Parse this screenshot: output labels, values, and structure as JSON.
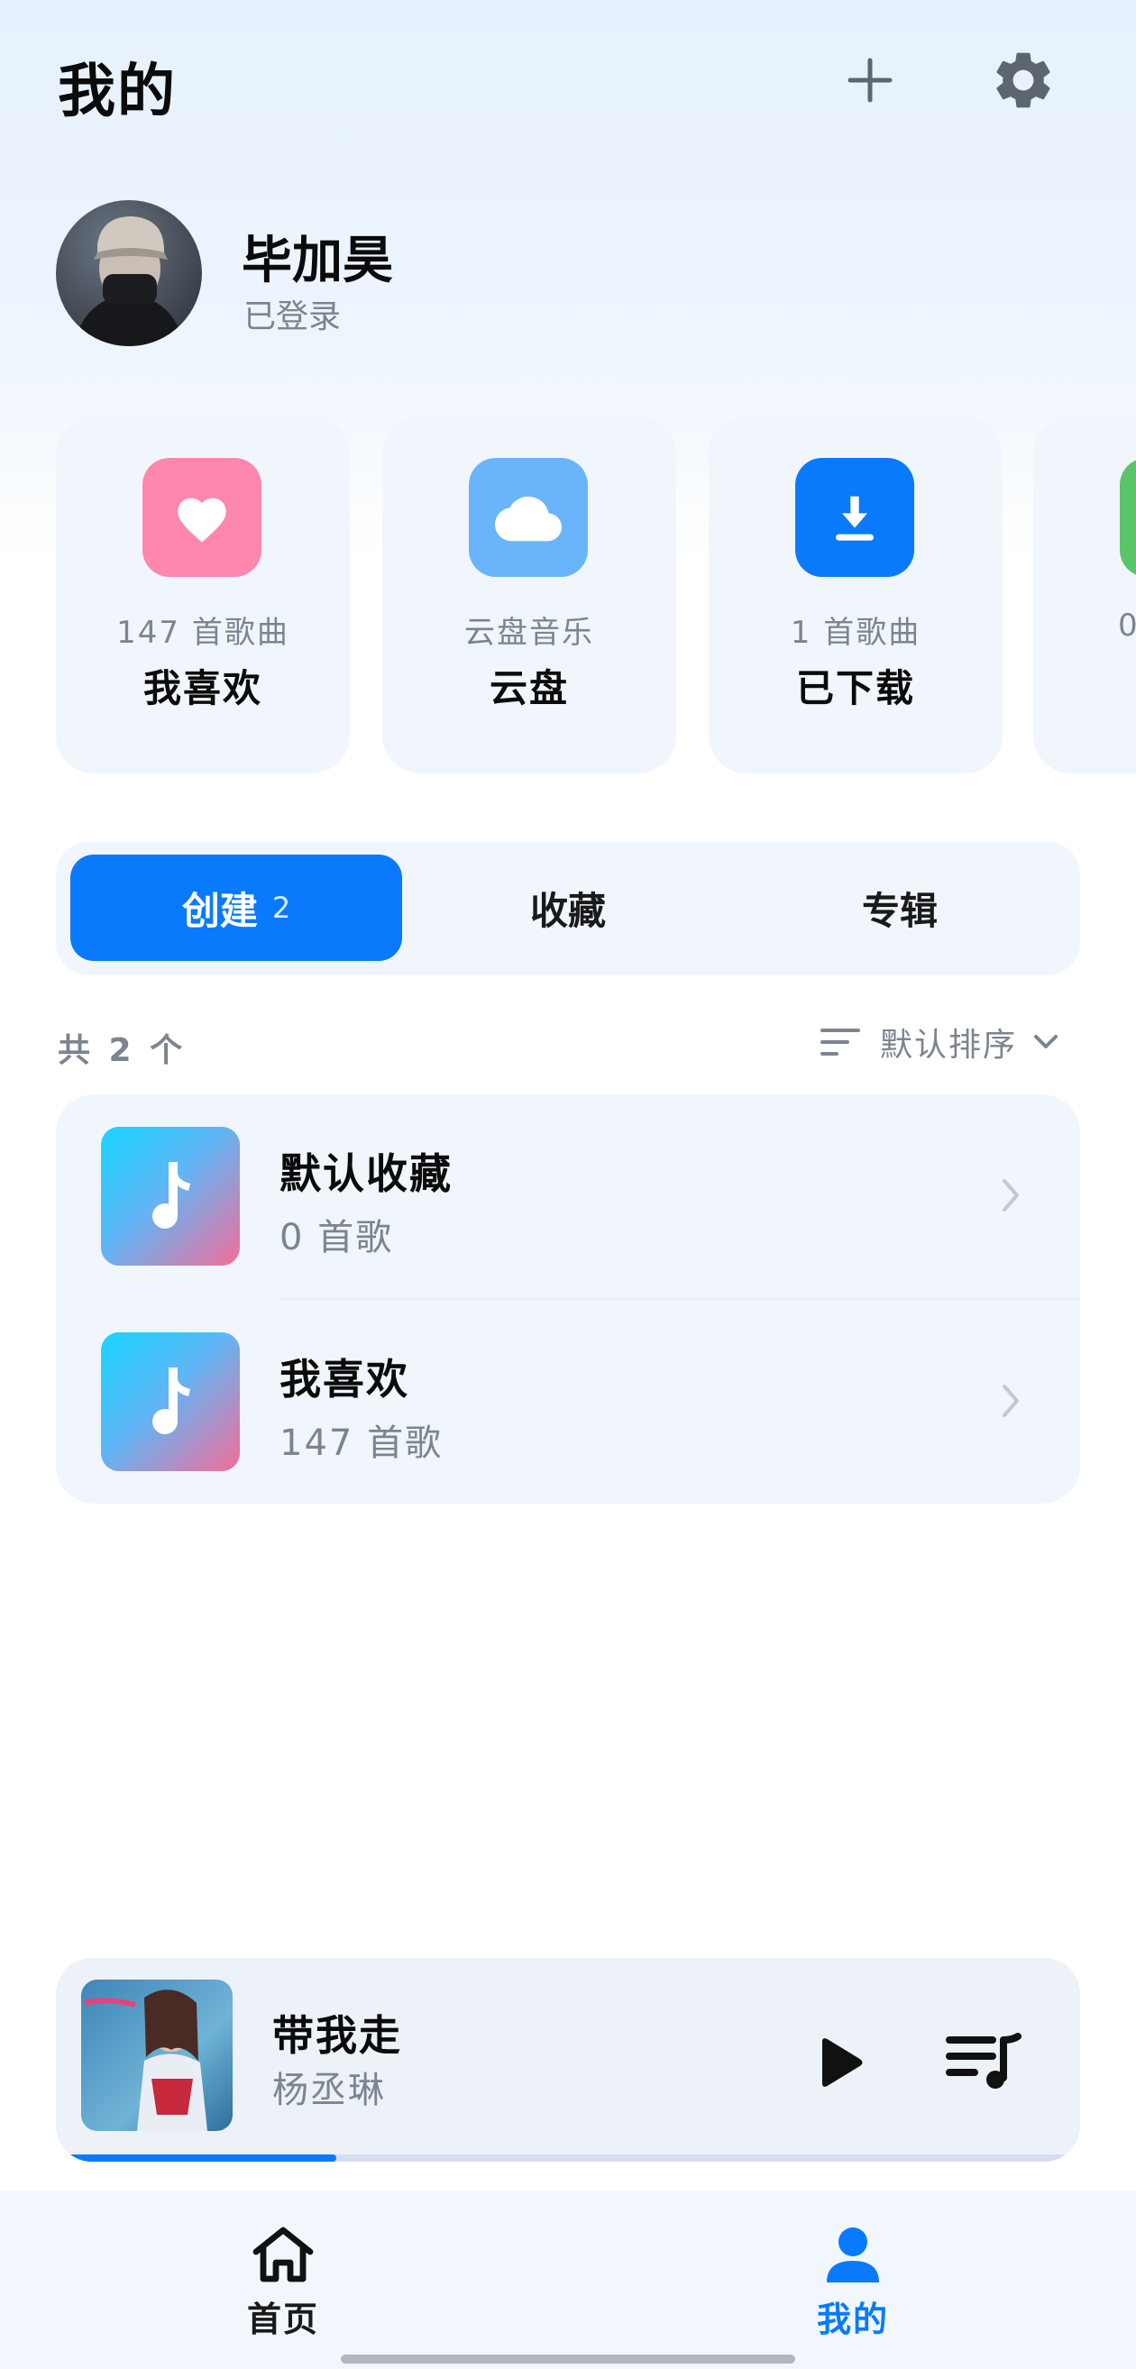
{
  "header": {
    "title": "我的",
    "add_icon": "plus-icon",
    "settings_icon": "gear-icon"
  },
  "profile": {
    "name": "毕加昊",
    "status": "已登录"
  },
  "quick_cards": [
    {
      "icon": "heart-icon",
      "color": "#ff86ad",
      "subtitle": "147 首歌曲",
      "title": "我喜欢"
    },
    {
      "icon": "cloud-icon",
      "color": "#6ab4fb",
      "subtitle": "云盘音乐",
      "title": "云盘"
    },
    {
      "icon": "download-icon",
      "color": "#0a7afc",
      "subtitle": "1 首歌曲",
      "title": "已下载"
    },
    {
      "icon": "partial-card-icon",
      "color": "#5ac567",
      "subtitle": "0",
      "title": ""
    }
  ],
  "tabs": [
    {
      "label": "创建",
      "count": "2",
      "active": true
    },
    {
      "label": "收藏",
      "count": "",
      "active": false
    },
    {
      "label": "专辑",
      "count": "",
      "active": false
    }
  ],
  "list_header": {
    "count_label": "共 2 个",
    "sort_label": "默认排序"
  },
  "playlists": [
    {
      "title": "默认收藏",
      "subtitle": "0 首歌"
    },
    {
      "title": "我喜欢",
      "subtitle": "147 首歌"
    }
  ],
  "now_playing": {
    "title": "带我走",
    "artist": "杨丞琳",
    "progress": 0.27
  },
  "bottom_nav": [
    {
      "label": "首页",
      "icon": "home-icon",
      "active": false
    },
    {
      "label": "我的",
      "icon": "user-icon",
      "active": true
    }
  ],
  "colors": {
    "accent": "#0a7afc",
    "muted_text": "#7c8490",
    "card_bg": "#f1f6fd"
  }
}
